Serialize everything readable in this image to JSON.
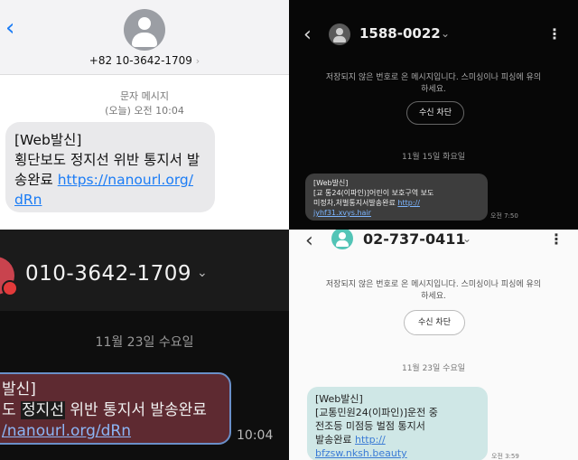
{
  "p1": {
    "sender": "+82 10-3642-1709",
    "meta_type": "문자 메시지",
    "meta_time": "(오늘) 오전 10:04",
    "msg_line1": "[Web발신]",
    "msg_line2": "횡단보도 정지선 위반 통지서 발",
    "msg_line3_text": "송완료 ",
    "msg_link1": "https://nanourl.org/",
    "msg_link2": "dRn"
  },
  "p2": {
    "sender": "1588-0022",
    "warning": "저장되지 않은 번호로 온 메시지입니다. 스미싱이나 피싱에 유의하세요.",
    "block_button": "수신 차단",
    "date": "11월 15일 화요일",
    "msg_line1": "[Web발신]",
    "msg_line2": "[교 통24(이파인)]어린이 보호구역 보도",
    "msg_line3_text": "미정차,처벌통지서발송완료 ",
    "msg_link1": "http://",
    "msg_link2": "jyhf31.xvys.hair",
    "time": "오전 7:50"
  },
  "p3": {
    "sender": "010-3642-1709",
    "date": "11월 23일 수요일",
    "msg_line1": "발신]",
    "msg_line2_pre": "도 ",
    "msg_line2_hl": "정지선",
    "msg_line2_post": " 위반 통지서 발송완료",
    "msg_link": "/nanourl.org/dRn",
    "time": "10:04"
  },
  "p4": {
    "sender": "02-737-0411",
    "warning": "저장되지 않은 번호로 온 메시지입니다. 스미싱이나 피싱에 유의하세요.",
    "block_button": "수신 차단",
    "date": "11월 23일 수요일",
    "msg_line1": "[Web발신]",
    "msg_line2": "[교통민원24(이파인)]운전 중",
    "msg_line3": "전조등 미점등 벌점 통지서",
    "msg_line4_text": "발송완료 ",
    "msg_link1": "http://",
    "msg_link2": "bfzsw.nksh.beauty",
    "time": "오전 3:59"
  }
}
